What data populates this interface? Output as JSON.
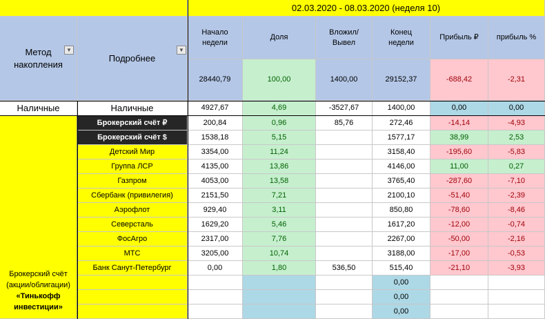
{
  "period": "02.03.2020 - 08.03.2020 (неделя 10)",
  "headers": {
    "method": "Метод накопления",
    "detail": "Подробнее",
    "start": "Начало недели",
    "share": "Доля",
    "deposit": "Вложил/ Вывел",
    "end": "Конец недели",
    "profit_rub": "Прибыль ₽",
    "profit_pct": "прибыль %"
  },
  "dropdown_icon": "triangle-down",
  "totals": {
    "start": "28440,79",
    "share": "100,00",
    "deposit": "1400,00",
    "end": "29152,37",
    "profit_rub": "-688,42",
    "profit_pct": "-2,31"
  },
  "cash": {
    "method": "Наличные",
    "detail": "Наличные",
    "start": "4927,67",
    "share": "4,69",
    "deposit": "-3527,67",
    "end": "1400,00",
    "profit_rub": "0,00",
    "profit_pct": "0,00"
  },
  "broker_label": {
    "line1": "Брокерский счёт",
    "line2": "(акции/облигации)",
    "line3": "«Тинькофф",
    "line4": "инвестиции»"
  },
  "rows": [
    {
      "name": "Брокерский счёт  ₽",
      "start": "200,84",
      "share": "0,96",
      "deposit": "85,76",
      "end": "272,46",
      "profit_rub": "-14,14",
      "profit_pct": "-4,93",
      "style": "dark",
      "pstyle": "red"
    },
    {
      "name": "Брокерский счёт  $",
      "start": "1538,18",
      "share": "5,15",
      "deposit": "",
      "end": "1577,17",
      "profit_rub": "38,99",
      "profit_pct": "2,53",
      "style": "dark",
      "pstyle": "green"
    },
    {
      "name": "Детский Мир",
      "start": "3354,00",
      "share": "11,24",
      "deposit": "",
      "end": "3158,40",
      "profit_rub": "-195,60",
      "profit_pct": "-5,83",
      "style": "yellow",
      "pstyle": "red"
    },
    {
      "name": "Группа ЛСР",
      "start": "4135,00",
      "share": "13,86",
      "deposit": "",
      "end": "4146,00",
      "profit_rub": "11,00",
      "profit_pct": "0,27",
      "style": "yellow",
      "pstyle": "green"
    },
    {
      "name": "Газпром",
      "start": "4053,00",
      "share": "13,58",
      "deposit": "",
      "end": "3765,40",
      "profit_rub": "-287,60",
      "profit_pct": "-7,10",
      "style": "yellow",
      "pstyle": "red"
    },
    {
      "name": "Сбербанк (привилегия)",
      "start": "2151,50",
      "share": "7,21",
      "deposit": "",
      "end": "2100,10",
      "profit_rub": "-51,40",
      "profit_pct": "-2,39",
      "style": "yellow",
      "pstyle": "red"
    },
    {
      "name": "Аэрофлот",
      "start": "929,40",
      "share": "3,11",
      "deposit": "",
      "end": "850,80",
      "profit_rub": "-78,60",
      "profit_pct": "-8,46",
      "style": "yellow",
      "pstyle": "red"
    },
    {
      "name": "Северсталь",
      "start": "1629,20",
      "share": "5,46",
      "deposit": "",
      "end": "1617,20",
      "profit_rub": "-12,00",
      "profit_pct": "-0,74",
      "style": "yellow",
      "pstyle": "red"
    },
    {
      "name": "ФосАгро",
      "start": "2317,00",
      "share": "7,76",
      "deposit": "",
      "end": "2267,00",
      "profit_rub": "-50,00",
      "profit_pct": "-2,16",
      "style": "yellow",
      "pstyle": "red"
    },
    {
      "name": "МТС",
      "start": "3205,00",
      "share": "10,74",
      "deposit": "",
      "end": "3188,00",
      "profit_rub": "-17,00",
      "profit_pct": "-0,53",
      "style": "yellow",
      "pstyle": "red"
    },
    {
      "name": "Банк Санут-Петербург",
      "start": "0,00",
      "share": "1,80",
      "deposit": "536,50",
      "end": "515,40",
      "profit_rub": "-21,10",
      "profit_pct": "-3,93",
      "style": "yellow",
      "pstyle": "red"
    },
    {
      "name": "",
      "start": "",
      "share": "",
      "deposit": "",
      "end": "0,00",
      "profit_rub": "",
      "profit_pct": "",
      "style": "yellow",
      "pstyle": "none",
      "endblue": true
    },
    {
      "name": "",
      "start": "",
      "share": "",
      "deposit": "",
      "end": "0,00",
      "profit_rub": "",
      "profit_pct": "",
      "style": "yellow",
      "pstyle": "none",
      "endblue": true
    },
    {
      "name": "",
      "start": "",
      "share": "",
      "deposit": "",
      "end": "0,00",
      "profit_rub": "",
      "profit_pct": "",
      "style": "yellow",
      "pstyle": "none",
      "endblue": true
    }
  ],
  "colors": {
    "header_yellow": "#ffff00",
    "header_blue": "#b4c7e7",
    "positive_bg": "#c6efce",
    "negative_bg": "#ffc7ce",
    "neutral_bg": "#add8e6"
  }
}
